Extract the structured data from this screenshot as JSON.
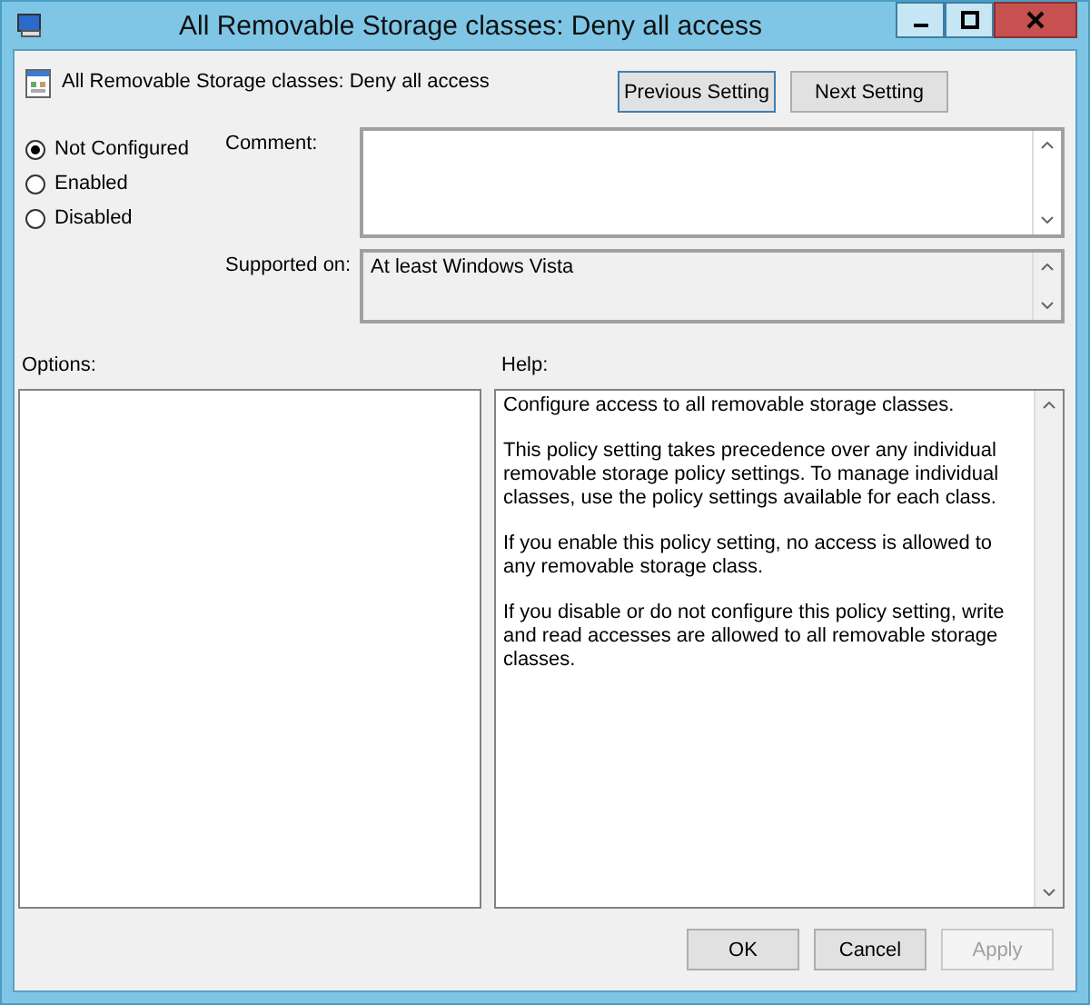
{
  "window": {
    "title": "All Removable Storage classes: Deny all access"
  },
  "header": {
    "title": "All Removable Storage classes: Deny all access",
    "buttons": [
      {
        "label": "Previous Setting",
        "focused": true
      },
      {
        "label": "Next Setting",
        "focused": false
      }
    ]
  },
  "state_options": [
    {
      "label": "Not Configured",
      "selected": true
    },
    {
      "label": "Enabled",
      "selected": false
    },
    {
      "label": "Disabled",
      "selected": false
    }
  ],
  "comment": {
    "label": "Comment:"
  },
  "supported_on": {
    "label": "Supported on:",
    "value": "At least Windows Vista"
  },
  "options": {
    "label": "Options:"
  },
  "help": {
    "label": "Help:",
    "paragraphs": [
      "Configure access to all removable storage classes.",
      "This policy setting takes precedence over any individual removable storage policy settings. To manage individual classes, use the policy settings available for each class.",
      "If you enable this policy setting, no access is allowed to any removable storage class.",
      "If you disable or do not configure this policy setting, write and read accesses are allowed to all removable storage classes."
    ]
  },
  "buttons": [
    {
      "label": "OK",
      "disabled": false
    },
    {
      "label": "Cancel",
      "disabled": false
    },
    {
      "label": "Apply",
      "disabled": true
    }
  ]
}
